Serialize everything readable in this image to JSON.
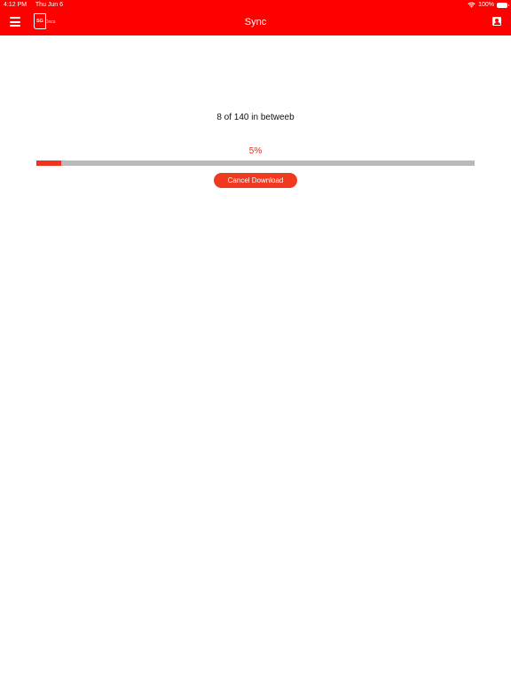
{
  "status_bar": {
    "time": "4:12 PM",
    "date": "Thu Jun 6",
    "battery": "100%"
  },
  "nav": {
    "title": "Sync",
    "logo_mark": "SG",
    "logo_text": "Docs"
  },
  "icons": {
    "menu": "menu-icon",
    "logo": "sg-docs-logo-icon",
    "profile": "profile-icon",
    "wifi": "wifi-icon",
    "battery": "battery-icon"
  },
  "sync": {
    "progress_text": "8 of 140 in betweeb",
    "percent_label": "5%",
    "progress_fraction": 0.057,
    "cancel_label": "Cancel Download"
  },
  "colors": {
    "header": "#ff0000",
    "accent": "#ee3320",
    "track": "#b9b9b9"
  }
}
